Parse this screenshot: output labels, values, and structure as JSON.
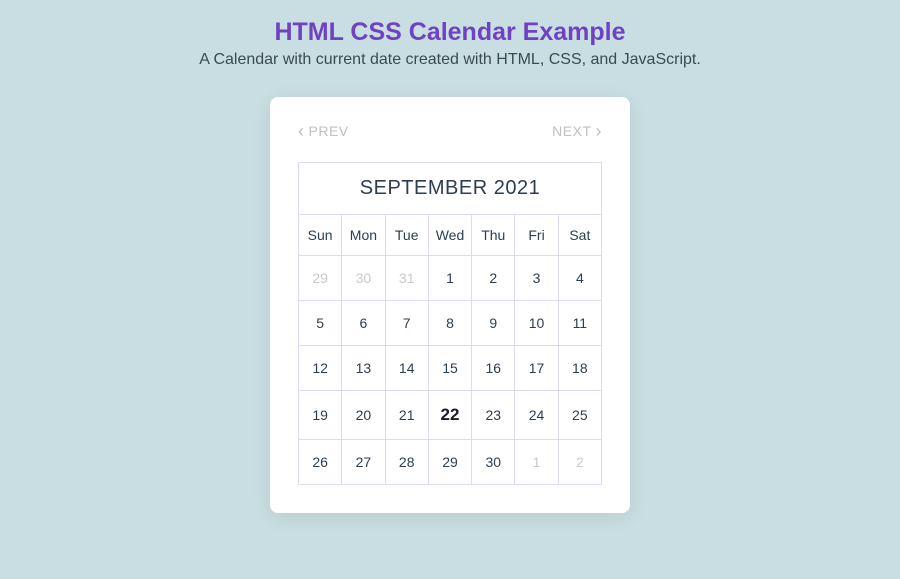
{
  "header": {
    "title": "HTML CSS Calendar Example",
    "subtitle": "A Calendar with current date created with HTML, CSS, and JavaScript."
  },
  "nav": {
    "prev_label": "PREV",
    "next_label": "NEXT"
  },
  "calendar": {
    "month_year": "SEPTEMBER 2021",
    "day_headers": [
      "Sun",
      "Mon",
      "Tue",
      "Wed",
      "Thu",
      "Fri",
      "Sat"
    ],
    "today_index": [
      3,
      3
    ],
    "weeks": [
      [
        {
          "day": "29",
          "out": true
        },
        {
          "day": "30",
          "out": true
        },
        {
          "day": "31",
          "out": true
        },
        {
          "day": "1",
          "out": false
        },
        {
          "day": "2",
          "out": false
        },
        {
          "day": "3",
          "out": false
        },
        {
          "day": "4",
          "out": false
        }
      ],
      [
        {
          "day": "5",
          "out": false
        },
        {
          "day": "6",
          "out": false
        },
        {
          "day": "7",
          "out": false
        },
        {
          "day": "8",
          "out": false
        },
        {
          "day": "9",
          "out": false
        },
        {
          "day": "10",
          "out": false
        },
        {
          "day": "11",
          "out": false
        }
      ],
      [
        {
          "day": "12",
          "out": false
        },
        {
          "day": "13",
          "out": false
        },
        {
          "day": "14",
          "out": false
        },
        {
          "day": "15",
          "out": false
        },
        {
          "day": "16",
          "out": false
        },
        {
          "day": "17",
          "out": false
        },
        {
          "day": "18",
          "out": false
        }
      ],
      [
        {
          "day": "19",
          "out": false
        },
        {
          "day": "20",
          "out": false
        },
        {
          "day": "21",
          "out": false
        },
        {
          "day": "22",
          "out": false
        },
        {
          "day": "23",
          "out": false
        },
        {
          "day": "24",
          "out": false
        },
        {
          "day": "25",
          "out": false
        }
      ],
      [
        {
          "day": "26",
          "out": false
        },
        {
          "day": "27",
          "out": false
        },
        {
          "day": "28",
          "out": false
        },
        {
          "day": "29",
          "out": false
        },
        {
          "day": "30",
          "out": false
        },
        {
          "day": "1",
          "out": true
        },
        {
          "day": "2",
          "out": true
        }
      ]
    ]
  }
}
